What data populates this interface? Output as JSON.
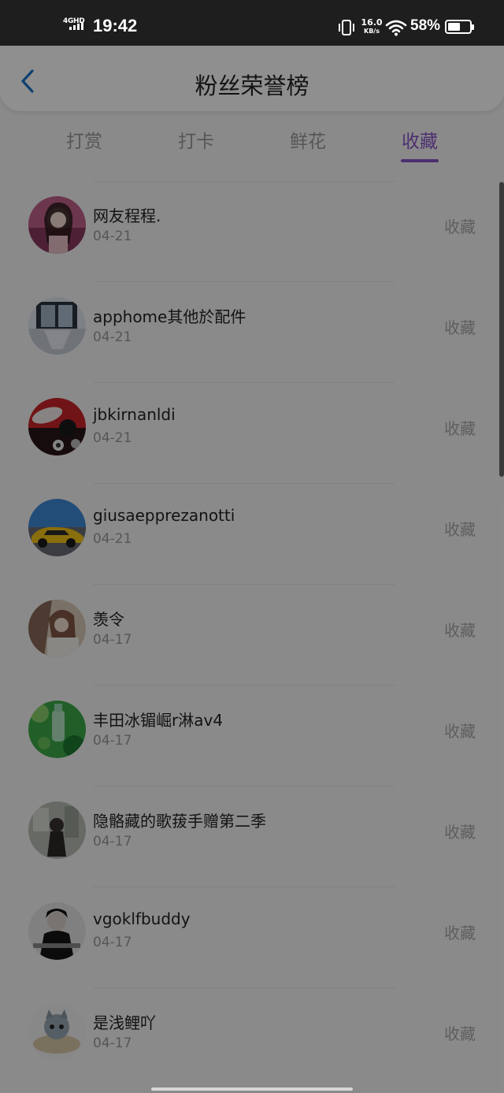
{
  "status_bar": {
    "network": "4GHD",
    "time": "19:42",
    "net_speed_value": "16.0",
    "net_speed_unit": "KB/s",
    "battery_percent": "58%",
    "battery_level": 0.58
  },
  "header": {
    "title": "粉丝荣誉榜"
  },
  "tabs": [
    {
      "label": "打赏",
      "active": false
    },
    {
      "label": "打卡",
      "active": false
    },
    {
      "label": "鲜花",
      "active": false
    },
    {
      "label": "收藏",
      "active": true
    }
  ],
  "fans": [
    {
      "name": "网友程程.",
      "date": "04-21",
      "action": "收藏"
    },
    {
      "name": "apphome其他於配件",
      "date": "04-21",
      "action": "收藏"
    },
    {
      "name": "jbkirnanldi",
      "date": "04-21",
      "action": "收藏"
    },
    {
      "name": "giusaepprezanotti",
      "date": "04-21",
      "action": "收藏"
    },
    {
      "name": "羡令",
      "date": "04-17",
      "action": "收藏"
    },
    {
      "name": "丰田冰镅崛r淋av4",
      "date": "04-17",
      "action": "收藏"
    },
    {
      "name": "隐骼藏的歌菝手赠第二季",
      "date": "04-17",
      "action": "收藏"
    },
    {
      "name": "vgoklfbuddy",
      "date": "04-17",
      "action": "收藏"
    },
    {
      "name": "是浅鲤吖",
      "date": "04-17",
      "action": "收藏"
    }
  ],
  "colors": {
    "accent": "#8a54c8",
    "back_icon": "#1a73c8",
    "overlay": "rgba(0,0,0,0.44)"
  },
  "icons": {
    "back": "chevron-left-icon",
    "vibrate": "vibrate-icon",
    "wifi": "wifi-icon",
    "battery": "battery-icon",
    "signal": "signal-icon"
  }
}
